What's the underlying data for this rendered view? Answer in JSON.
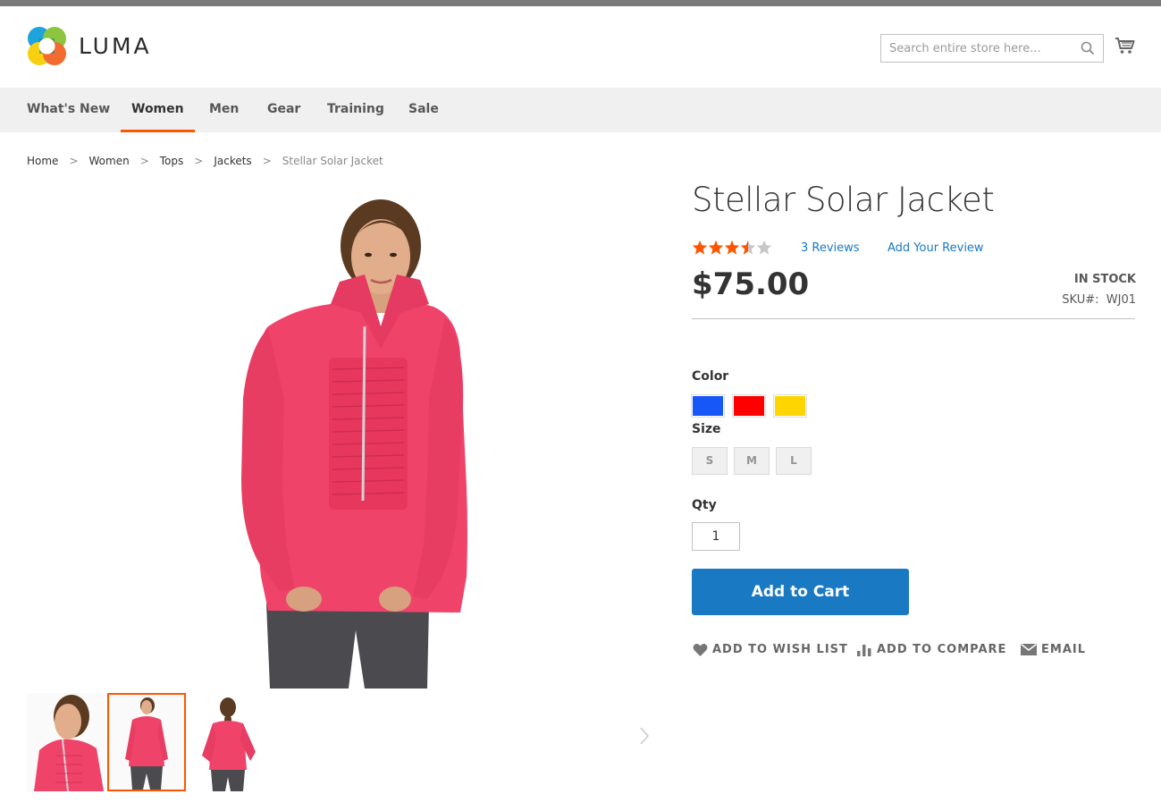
{
  "brand": {
    "name": "LUMA",
    "accent_color": "#ff5501",
    "link_color": "#1979c3"
  },
  "header": {
    "search_placeholder": "Search entire store here...",
    "search_icon": "search-icon",
    "cart_icon": "cart-icon"
  },
  "nav": {
    "items": [
      {
        "label": "What's New",
        "active": false
      },
      {
        "label": "Women",
        "active": true
      },
      {
        "label": "Men",
        "active": false
      },
      {
        "label": "Gear",
        "active": false
      },
      {
        "label": "Training",
        "active": false
      },
      {
        "label": "Sale",
        "active": false
      }
    ]
  },
  "breadcrumb": {
    "items": [
      "Home",
      "Women",
      "Tops",
      "Jackets",
      "Stellar Solar Jacket"
    ],
    "separator": ">"
  },
  "product": {
    "title": "Stellar Solar Jacket",
    "rating_stars": 3.5,
    "rating_max": 5,
    "reviews_link": "3 Reviews",
    "add_review_link": "Add Your Review",
    "price": "$75.00",
    "stock": "IN STOCK",
    "sku_label": "SKU#:",
    "sku_value": "WJ01",
    "color_label": "Color",
    "colors": [
      {
        "name": "Blue",
        "hex": "#1857f7"
      },
      {
        "name": "Red",
        "hex": "#ff0000"
      },
      {
        "name": "Yellow",
        "hex": "#ffd500"
      }
    ],
    "size_label": "Size",
    "sizes": [
      "S",
      "M",
      "L"
    ],
    "qty_label": "Qty",
    "qty_value": "1",
    "add_to_cart": "Add to Cart",
    "actions": {
      "wishlist": "ADD TO WISH LIST",
      "compare": "ADD TO COMPARE",
      "email": "EMAIL"
    }
  },
  "gallery": {
    "jacket_color": "#f0436a",
    "thumbs": [
      {
        "view": "close-up-front",
        "active": false
      },
      {
        "view": "full-front",
        "active": true
      },
      {
        "view": "back",
        "active": false
      }
    ]
  }
}
